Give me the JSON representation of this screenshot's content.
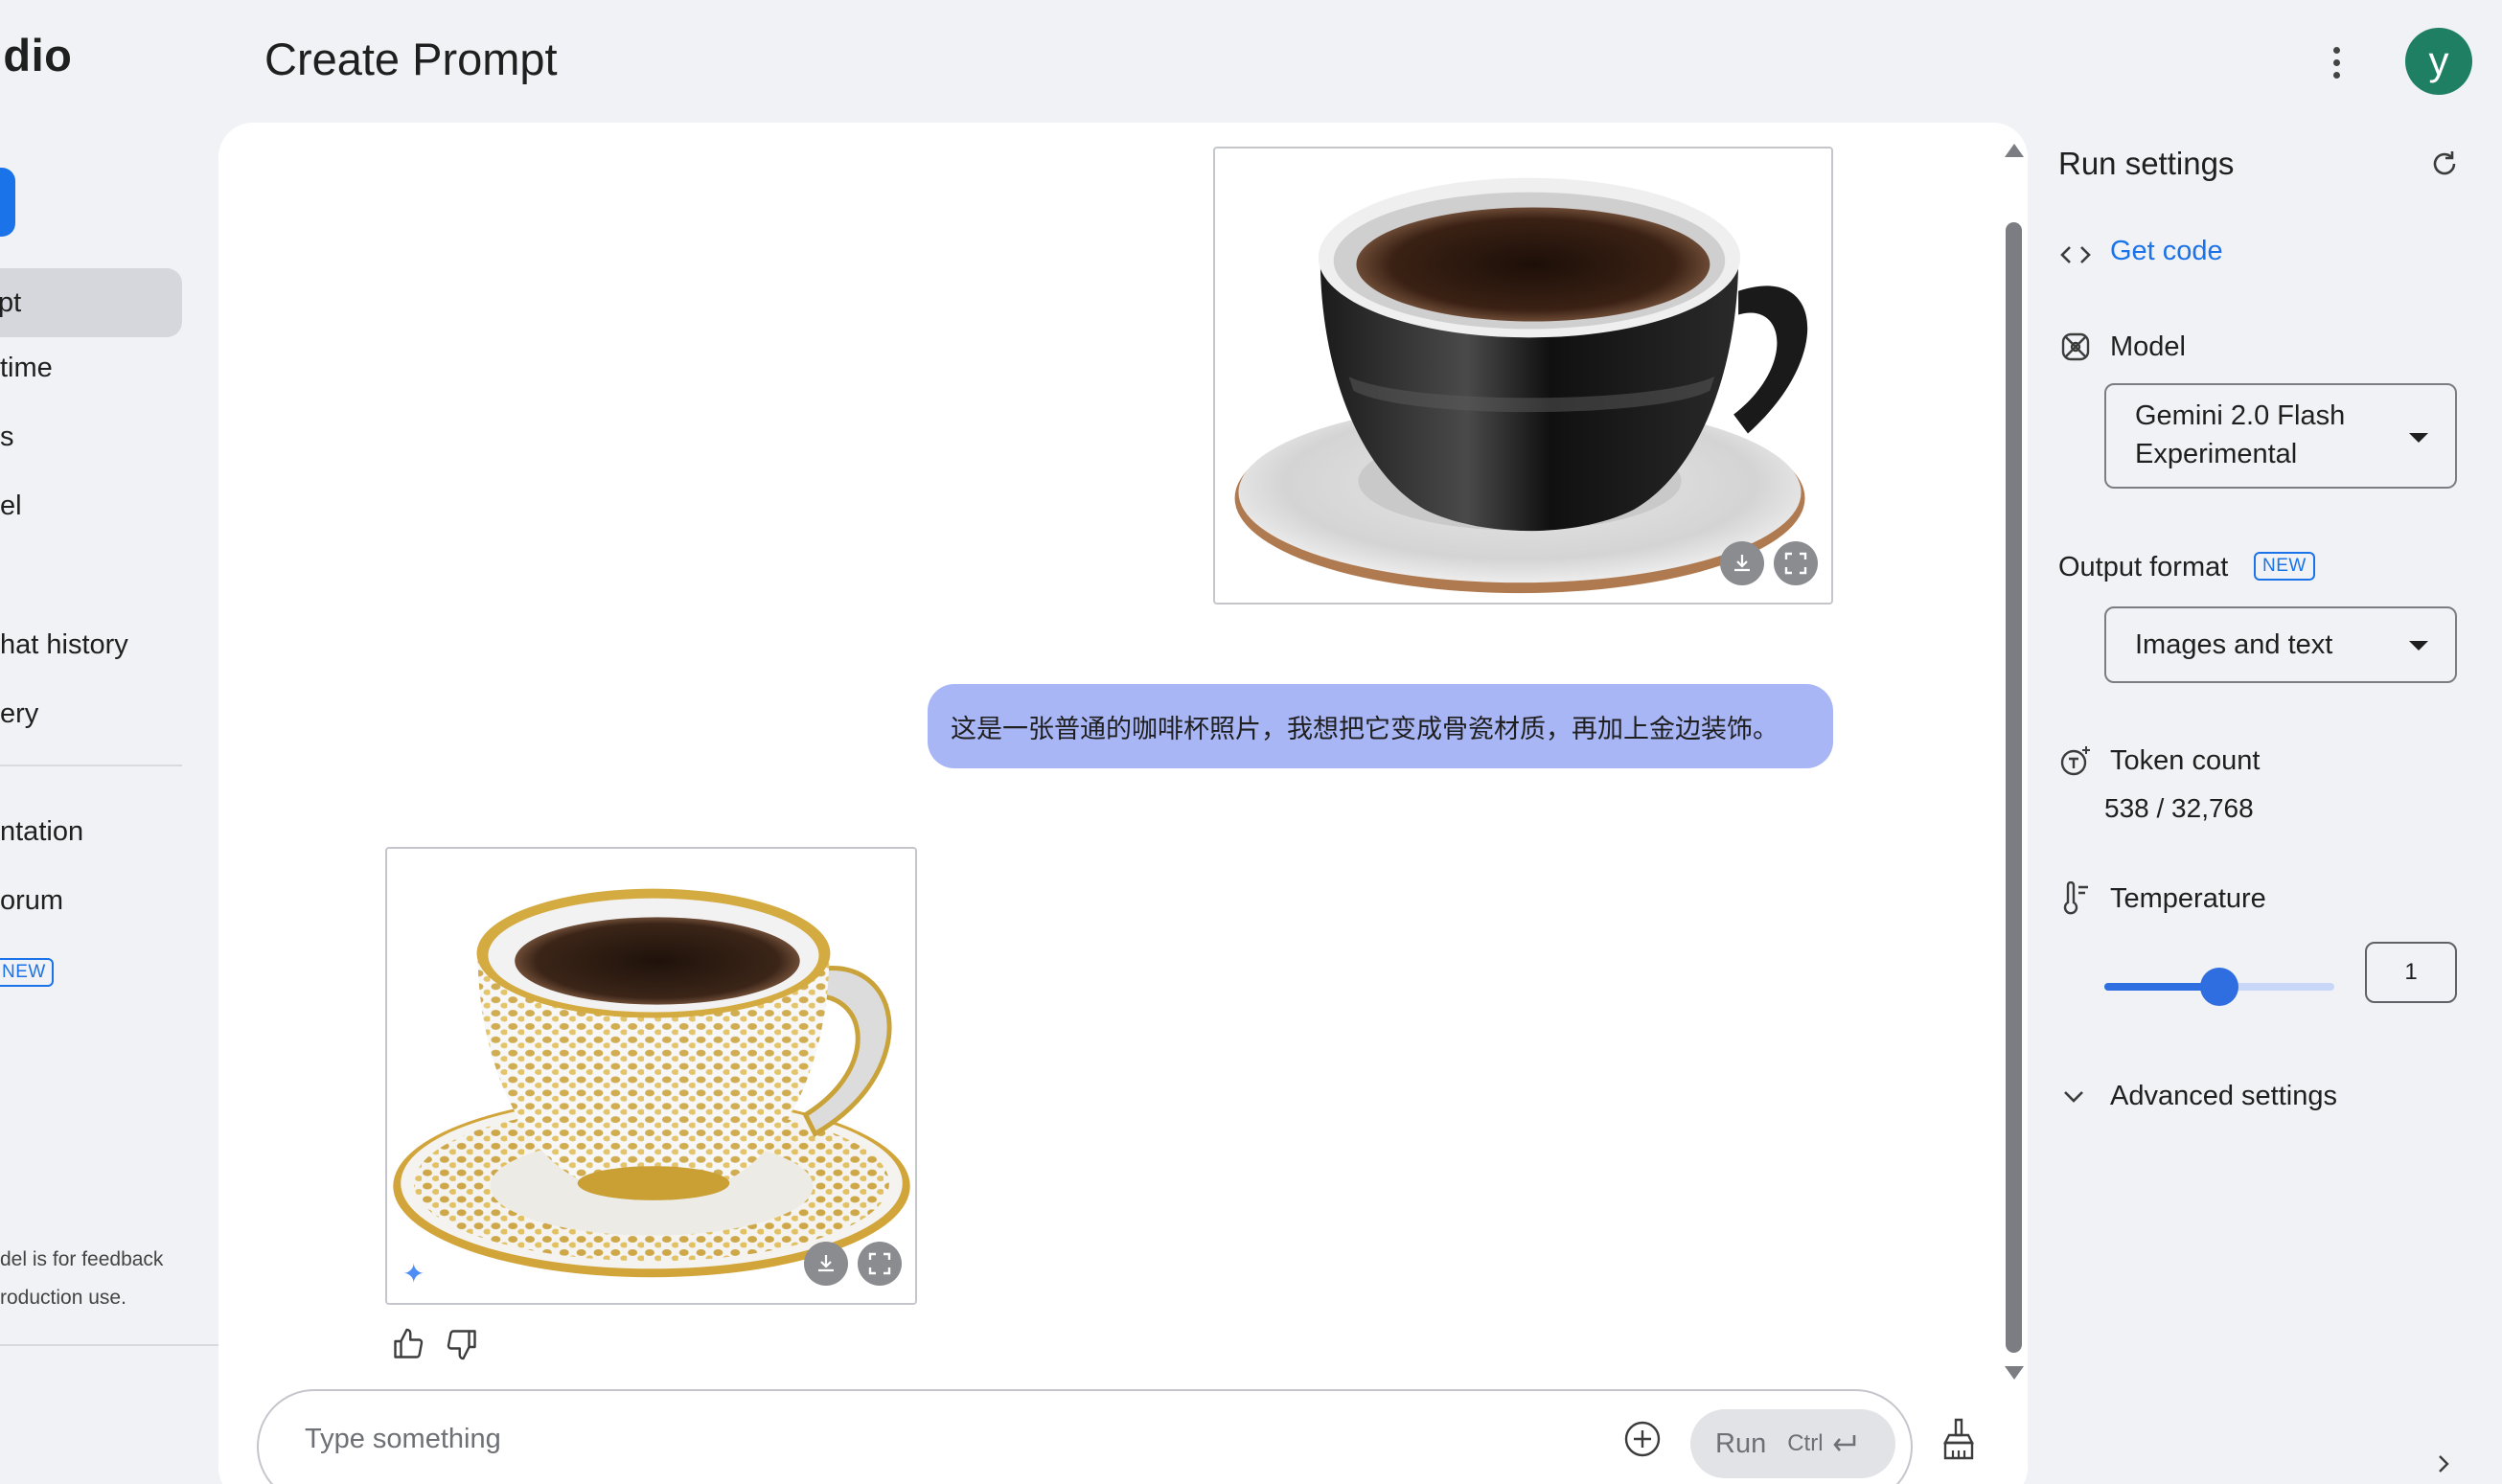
{
  "header": {
    "brand": "tudio",
    "title": "Create Prompt",
    "avatar_initial": "y",
    "avatar_color": "#1e7f63"
  },
  "sidebar": {
    "items": [
      {
        "label": "pt",
        "active": true
      },
      {
        "label": "time"
      },
      {
        "label": "s"
      },
      {
        "label": "el"
      },
      {
        "label": "hat history"
      },
      {
        "label": "ery"
      },
      {
        "label": "ntation"
      },
      {
        "label": "orum"
      }
    ],
    "new_badge": "NEW",
    "note_line1": "del is for feedback",
    "note_line2": "roduction use."
  },
  "chat": {
    "user_message": "这是一张普通的咖啡杯照片，我想把它变成骨瓷材质，再加上金边装饰。",
    "user_image_icon": "black-coffee-cup-photo",
    "model_image_icon": "gold-rim-bone-china-cup-photo",
    "composer_placeholder": "Type something",
    "run_label": "Run",
    "run_shortcut": "Ctrl",
    "accent_color": "#a9b6f5"
  },
  "run_settings": {
    "title": "Run settings",
    "get_code": "Get code",
    "model_label": "Model",
    "model_value_line1": "Gemini 2.0 Flash",
    "model_value_line2": "Experimental",
    "output_format_label": "Output format",
    "output_format_badge": "NEW",
    "output_format_value": "Images and text",
    "token_count_label": "Token count",
    "token_count_value": "538 / 32,768",
    "temperature_label": "Temperature",
    "temperature_value": "1",
    "temperature_fraction": 0.5,
    "advanced_label": "Advanced settings",
    "link_color": "#1a73e8"
  }
}
